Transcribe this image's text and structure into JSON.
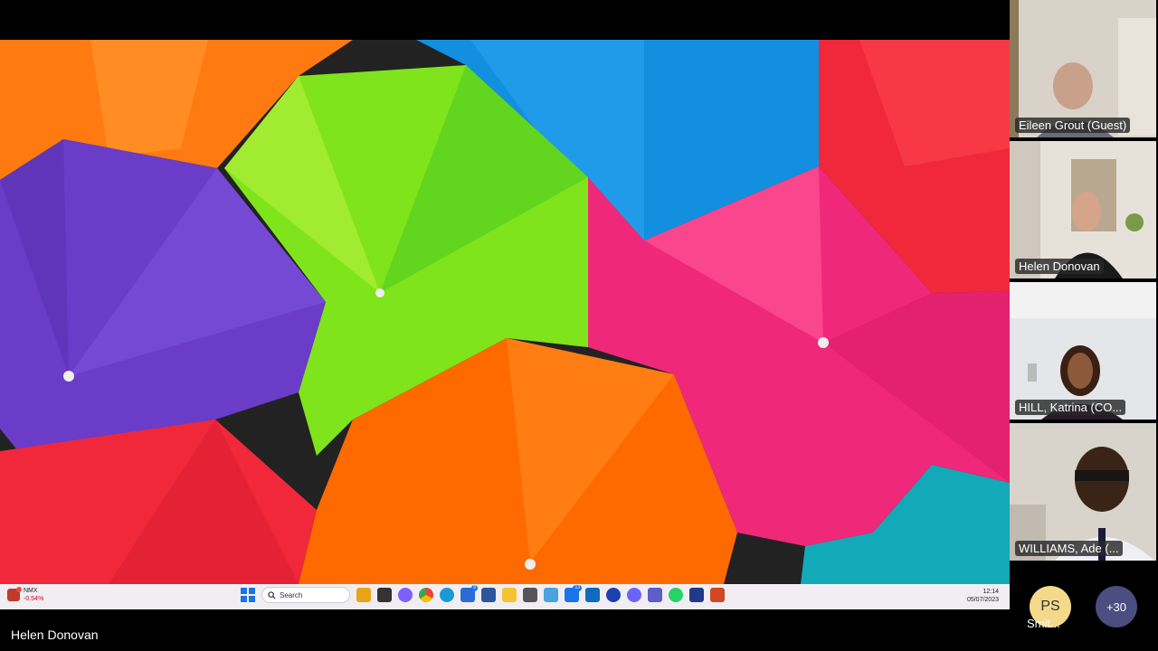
{
  "presenter": {
    "name": "Helen Donovan"
  },
  "taskbar": {
    "stock_symbol": "NMX",
    "stock_change": "-0.54%",
    "search_placeholder": "Search",
    "teams_badge": "13",
    "edge_badge": "8",
    "time": "12:14",
    "date": "05/07/2023"
  },
  "participants": [
    {
      "name": "Eileen Grout (Guest)"
    },
    {
      "name": "Helen Donovan"
    },
    {
      "name": "HILL, Katrina (CO..."
    },
    {
      "name": "WILLIAMS, Ade (..."
    }
  ],
  "overflow": {
    "avatar_initials": "PS",
    "avatar_name": "Smit...",
    "more_count": "+30"
  },
  "colors": {
    "umbrella_orange": "#ff6a00",
    "umbrella_green": "#7fe41c",
    "umbrella_blue": "#138fe0",
    "umbrella_red": "#f0283a",
    "umbrella_purple": "#6a3cc8",
    "umbrella_pink": "#f0287a",
    "umbrella_teal": "#12aab8",
    "more_badge": "#4a4e80",
    "avatar_bg": "#f5d98a"
  }
}
